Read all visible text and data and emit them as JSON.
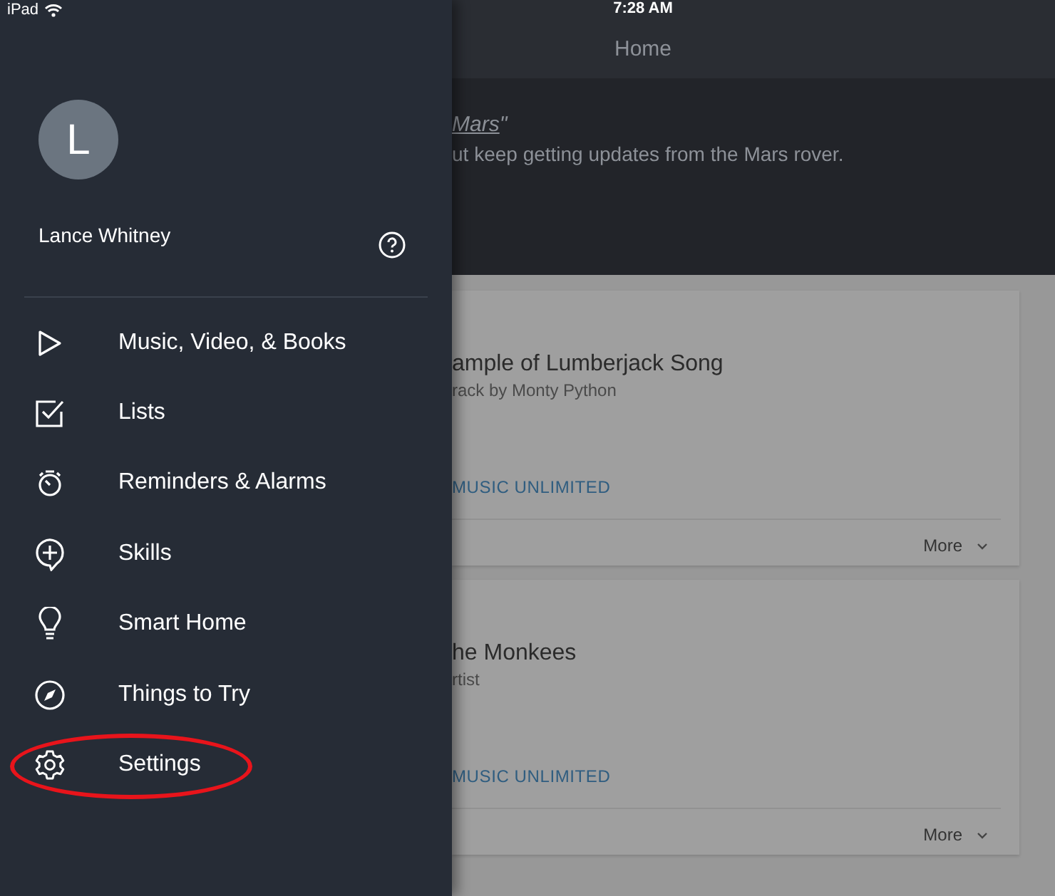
{
  "status_bar": {
    "device": "iPad",
    "time": "7:28 AM"
  },
  "header": {
    "title": "Home"
  },
  "banner": {
    "link": "Mars",
    "link_suffix": "\"",
    "text": "ut keep getting updates from the Mars rover."
  },
  "cards": [
    {
      "title": "ample of Lumberjack Song",
      "subtitle": "rack by Monty Python",
      "tag": "MUSIC UNLIMITED",
      "more": "More"
    },
    {
      "title": "he Monkees",
      "subtitle": "rtist",
      "tag": "MUSIC UNLIMITED",
      "more": "More"
    }
  ],
  "drawer": {
    "avatar": "L",
    "user": "Lance Whitney",
    "items": [
      {
        "kind": "play",
        "label": "Music, Video, & Books",
        "highlighted": false
      },
      {
        "kind": "lists",
        "label": "Lists",
        "highlighted": false
      },
      {
        "kind": "alarm",
        "label": "Reminders & Alarms",
        "highlighted": false
      },
      {
        "kind": "skills",
        "label": "Skills",
        "highlighted": false
      },
      {
        "kind": "bulb",
        "label": "Smart Home",
        "highlighted": false
      },
      {
        "kind": "compass",
        "label": "Things to Try",
        "highlighted": false
      },
      {
        "kind": "gear",
        "label": "Settings",
        "highlighted": true
      }
    ]
  }
}
